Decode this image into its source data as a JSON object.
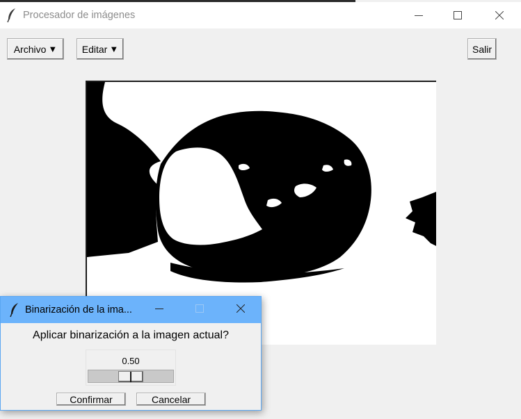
{
  "window": {
    "title": "Procesador de imágenes",
    "controls": {
      "minimize": "minimize-icon",
      "maximize": "maximize-icon",
      "close": "close-icon"
    }
  },
  "toolbar": {
    "archivo_label": "Archivo",
    "editar_label": "Editar",
    "menu_arrow": "▼",
    "salir_label": "Salir"
  },
  "canvas": {
    "image": "binarized-photo-of-apple"
  },
  "dialog": {
    "title": "Binarización de la ima...",
    "message": "Aplicar binarización a la imagen actual?",
    "threshold": {
      "value": 0.5,
      "value_label": "0.50",
      "min": 0,
      "max": 1
    },
    "confirm_label": "Confirmar",
    "cancel_label": "Cancelar"
  },
  "colors": {
    "dialog_titlebar": "#6cb3fb",
    "window_bg": "#f0f0f0",
    "image_foreground": "#000000",
    "image_background": "#ffffff"
  }
}
